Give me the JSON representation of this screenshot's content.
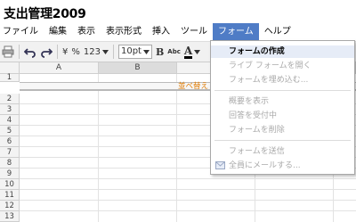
{
  "document": {
    "title": "支出管理2009"
  },
  "menubar": {
    "items": [
      {
        "label": "ファイル"
      },
      {
        "label": "編集"
      },
      {
        "label": "表示"
      },
      {
        "label": "表示形式"
      },
      {
        "label": "挿入"
      },
      {
        "label": "ツール"
      },
      {
        "label": "フォーム",
        "active": true
      },
      {
        "label": "ヘルプ"
      }
    ]
  },
  "toolbar": {
    "icons": [
      "printer-icon",
      "undo-icon",
      "redo-icon"
    ],
    "currency_label": "¥",
    "percent_label": "%",
    "number_format_label": "123",
    "font_size": "10pt",
    "bold_label": "B",
    "strikethrough_label": "Abc",
    "text_color_label": "A",
    "text_color": "#000000"
  },
  "grid": {
    "columns": [
      "A",
      "B"
    ],
    "rows": [
      "1",
      "2",
      "3",
      "4",
      "5",
      "6",
      "7",
      "8",
      "9",
      "10",
      "11",
      "12",
      "13"
    ],
    "frozen_row_label": "並べ替え"
  },
  "form_menu": {
    "items": [
      {
        "label": "フォームの作成",
        "enabled": true
      },
      {
        "label": "ライブ フォームを開く",
        "enabled": false
      },
      {
        "label": "フォームを埋め込む...",
        "enabled": false
      },
      {
        "label": "概要を表示",
        "enabled": false
      },
      {
        "label": "回答を受付中",
        "enabled": false
      },
      {
        "label": "フォームを削除",
        "enabled": false
      },
      {
        "label": "フォームを送信",
        "enabled": false
      },
      {
        "label": "全員にメールする...",
        "enabled": false,
        "icon": "mail-icon"
      }
    ]
  },
  "colors": {
    "menu_active_bg": "#4f7cc6",
    "sort_label": "#e07b00",
    "disabled_text": "#aaaaaa"
  }
}
